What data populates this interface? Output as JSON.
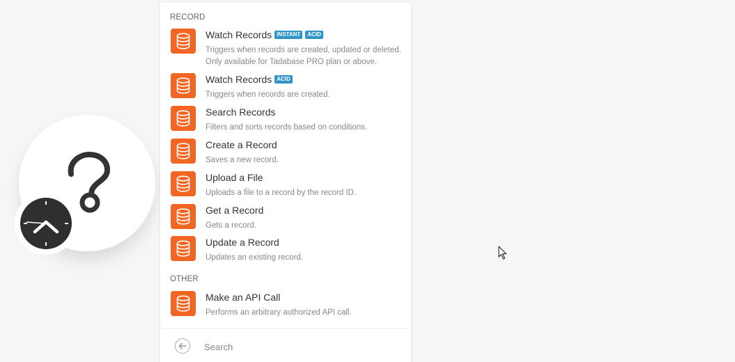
{
  "sections": [
    {
      "title": "RECORD",
      "items": [
        {
          "title": "Watch Records",
          "badges": [
            "INSTANT",
            "ACID"
          ],
          "description": "Triggers when records are created, updated or deleted. Only available for Tadabase PRO plan or above."
        },
        {
          "title": "Watch Records",
          "badges": [
            "ACID"
          ],
          "description": "Triggers when records are created."
        },
        {
          "title": "Search Records",
          "badges": [],
          "description": "Filters and sorts records based on conditions."
        },
        {
          "title": "Create a Record",
          "badges": [],
          "description": "Saves a new record."
        },
        {
          "title": "Upload a File",
          "badges": [],
          "description": "Uploads a file to a record by the record ID."
        },
        {
          "title": "Get a Record",
          "badges": [],
          "description": "Gets a record."
        },
        {
          "title": "Update a Record",
          "badges": [],
          "description": "Updates an existing record."
        }
      ]
    },
    {
      "title": "OTHER",
      "items": [
        {
          "title": "Make an API Call",
          "badges": [],
          "description": "Performs an arbitrary authorized API call."
        }
      ]
    }
  ],
  "search": {
    "placeholder": "Search",
    "value": ""
  },
  "icons": {
    "module_icon": "database-icon",
    "back": "arrow-left-circle-icon",
    "bubble": "question-mark-icon",
    "schedule": "clock-icon"
  },
  "colors": {
    "module_icon_bg": "#f26522",
    "badge_bg": "#2f95c8"
  }
}
